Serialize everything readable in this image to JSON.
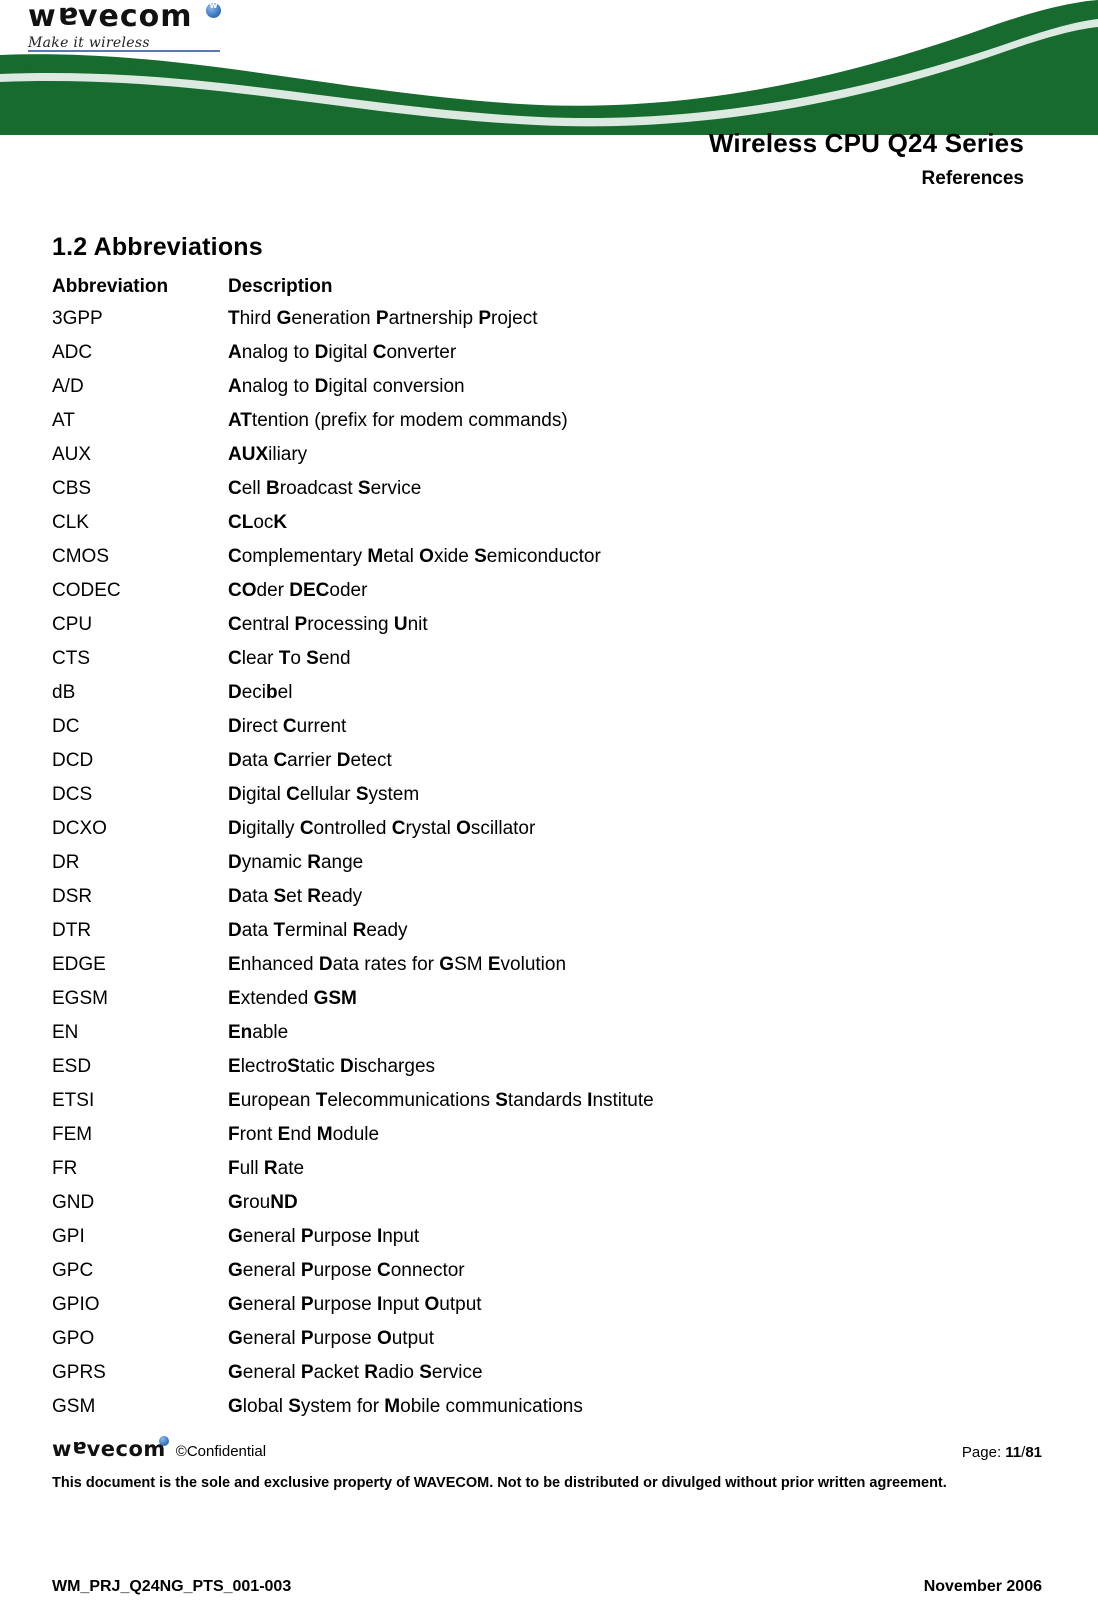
{
  "brand": {
    "logo_text_a": "w",
    "logo_text_b": "a",
    "logo_text_c": "vecom",
    "tagline": "Make it wireless",
    "accent_green": "#176b2f",
    "accent_blue": "#3f7fc4"
  },
  "header": {
    "doc_title": "Wireless CPU Q24 Series",
    "doc_subtitle": "References"
  },
  "section": {
    "heading": "1.2 Abbreviations"
  },
  "table": {
    "col_abbreviation": "Abbreviation",
    "col_description": "Description",
    "rows": [
      {
        "abbr": "3GPP",
        "parts": [
          [
            "T",
            1
          ],
          [
            "hird ",
            0
          ],
          [
            "G",
            1
          ],
          [
            "eneration ",
            0
          ],
          [
            "P",
            1
          ],
          [
            "artnership ",
            0
          ],
          [
            "P",
            1
          ],
          [
            "roject",
            0
          ]
        ]
      },
      {
        "abbr": "ADC",
        "parts": [
          [
            "A",
            1
          ],
          [
            "nalog to ",
            0
          ],
          [
            "D",
            1
          ],
          [
            "igital ",
            0
          ],
          [
            "C",
            1
          ],
          [
            "onverter",
            0
          ]
        ]
      },
      {
        "abbr": "A/D",
        "parts": [
          [
            "A",
            1
          ],
          [
            "nalog to ",
            0
          ],
          [
            "D",
            1
          ],
          [
            "igital conversion",
            0
          ]
        ]
      },
      {
        "abbr": "AT",
        "parts": [
          [
            "AT",
            1
          ],
          [
            "tention (prefix for modem commands)",
            0
          ]
        ]
      },
      {
        "abbr": "AUX",
        "parts": [
          [
            "AUX",
            1
          ],
          [
            "iliary",
            0
          ]
        ]
      },
      {
        "abbr": "CBS",
        "parts": [
          [
            "C",
            1
          ],
          [
            "ell ",
            0
          ],
          [
            "B",
            1
          ],
          [
            "roadcast ",
            0
          ],
          [
            "S",
            1
          ],
          [
            "ervice",
            0
          ]
        ]
      },
      {
        "abbr": "CLK",
        "parts": [
          [
            "CL",
            1
          ],
          [
            "oc",
            0
          ],
          [
            "K",
            1
          ]
        ]
      },
      {
        "abbr": "CMOS",
        "parts": [
          [
            "C",
            1
          ],
          [
            "omplementary ",
            0
          ],
          [
            "M",
            1
          ],
          [
            "etal ",
            0
          ],
          [
            "O",
            1
          ],
          [
            "xide ",
            0
          ],
          [
            "S",
            1
          ],
          [
            "emiconductor",
            0
          ]
        ]
      },
      {
        "abbr": "CODEC",
        "parts": [
          [
            "CO",
            1
          ],
          [
            "der ",
            0
          ],
          [
            "DEC",
            1
          ],
          [
            "oder",
            0
          ]
        ]
      },
      {
        "abbr": "CPU",
        "parts": [
          [
            "C",
            1
          ],
          [
            "entral ",
            0
          ],
          [
            "P",
            1
          ],
          [
            "rocessing ",
            0
          ],
          [
            "U",
            1
          ],
          [
            "nit",
            0
          ]
        ]
      },
      {
        "abbr": "CTS",
        "parts": [
          [
            "C",
            1
          ],
          [
            "lear ",
            0
          ],
          [
            "T",
            1
          ],
          [
            "o ",
            0
          ],
          [
            "S",
            1
          ],
          [
            "end",
            0
          ]
        ]
      },
      {
        "abbr": "dB",
        "parts": [
          [
            "D",
            1
          ],
          [
            "eci",
            0
          ],
          [
            "b",
            1
          ],
          [
            "el",
            0
          ]
        ]
      },
      {
        "abbr": "DC",
        "parts": [
          [
            "D",
            1
          ],
          [
            "irect ",
            0
          ],
          [
            "C",
            1
          ],
          [
            "urrent",
            0
          ]
        ]
      },
      {
        "abbr": "DCD",
        "parts": [
          [
            "D",
            1
          ],
          [
            "ata ",
            0
          ],
          [
            "C",
            1
          ],
          [
            "arrier ",
            0
          ],
          [
            "D",
            1
          ],
          [
            "etect",
            0
          ]
        ]
      },
      {
        "abbr": "DCS",
        "parts": [
          [
            "D",
            1
          ],
          [
            "igital ",
            0
          ],
          [
            "C",
            1
          ],
          [
            "ellular ",
            0
          ],
          [
            "S",
            1
          ],
          [
            "ystem",
            0
          ]
        ]
      },
      {
        "abbr": "DCXO",
        "parts": [
          [
            "D",
            1
          ],
          [
            "igitally ",
            0
          ],
          [
            "C",
            1
          ],
          [
            "ontrolled ",
            0
          ],
          [
            "C",
            1
          ],
          [
            "rystal ",
            0
          ],
          [
            "O",
            1
          ],
          [
            "scillator",
            0
          ]
        ]
      },
      {
        "abbr": "DR",
        "parts": [
          [
            "D",
            1
          ],
          [
            "ynamic ",
            0
          ],
          [
            "R",
            1
          ],
          [
            "ange",
            0
          ]
        ]
      },
      {
        "abbr": "DSR",
        "parts": [
          [
            "D",
            1
          ],
          [
            "ata ",
            0
          ],
          [
            "S",
            1
          ],
          [
            "et ",
            0
          ],
          [
            "R",
            1
          ],
          [
            "eady",
            0
          ]
        ]
      },
      {
        "abbr": "DTR",
        "parts": [
          [
            "D",
            1
          ],
          [
            "ata ",
            0
          ],
          [
            "T",
            1
          ],
          [
            "erminal ",
            0
          ],
          [
            "R",
            1
          ],
          [
            "eady",
            0
          ]
        ]
      },
      {
        "abbr": "EDGE",
        "parts": [
          [
            "E",
            1
          ],
          [
            "nhanced ",
            0
          ],
          [
            "D",
            1
          ],
          [
            "ata rates for ",
            0
          ],
          [
            "G",
            1
          ],
          [
            "SM ",
            0
          ],
          [
            "E",
            1
          ],
          [
            "volution",
            0
          ]
        ]
      },
      {
        "abbr": "EGSM",
        "parts": [
          [
            "E",
            1
          ],
          [
            "xtended ",
            0
          ],
          [
            "GSM",
            1
          ]
        ]
      },
      {
        "abbr": "EN",
        "parts": [
          [
            "En",
            1
          ],
          [
            "able",
            0
          ]
        ]
      },
      {
        "abbr": "ESD",
        "parts": [
          [
            "E",
            1
          ],
          [
            "lectro",
            0
          ],
          [
            "S",
            1
          ],
          [
            "tatic ",
            0
          ],
          [
            "D",
            1
          ],
          [
            "ischarges",
            0
          ]
        ]
      },
      {
        "abbr": "ETSI",
        "parts": [
          [
            "E",
            1
          ],
          [
            "uropean ",
            0
          ],
          [
            "T",
            1
          ],
          [
            "elecommunications ",
            0
          ],
          [
            "S",
            1
          ],
          [
            "tandards ",
            0
          ],
          [
            "I",
            1
          ],
          [
            "nstitute",
            0
          ]
        ]
      },
      {
        "abbr": "FEM",
        "parts": [
          [
            "F",
            1
          ],
          [
            "ront ",
            0
          ],
          [
            "E",
            1
          ],
          [
            "nd ",
            0
          ],
          [
            "M",
            1
          ],
          [
            "odule",
            0
          ]
        ]
      },
      {
        "abbr": "FR",
        "parts": [
          [
            "F",
            1
          ],
          [
            "ull ",
            0
          ],
          [
            "R",
            1
          ],
          [
            "ate",
            0
          ]
        ]
      },
      {
        "abbr": "GND",
        "parts": [
          [
            "G",
            1
          ],
          [
            "rou",
            0
          ],
          [
            "ND",
            1
          ]
        ]
      },
      {
        "abbr": "GPI",
        "parts": [
          [
            "G",
            1
          ],
          [
            "eneral ",
            0
          ],
          [
            "P",
            1
          ],
          [
            "urpose ",
            0
          ],
          [
            "I",
            1
          ],
          [
            "nput",
            0
          ]
        ]
      },
      {
        "abbr": "GPC",
        "parts": [
          [
            "G",
            1
          ],
          [
            "eneral ",
            0
          ],
          [
            "P",
            1
          ],
          [
            "urpose ",
            0
          ],
          [
            "C",
            1
          ],
          [
            "onnector",
            0
          ]
        ]
      },
      {
        "abbr": "GPIO",
        "parts": [
          [
            "G",
            1
          ],
          [
            "eneral ",
            0
          ],
          [
            "P",
            1
          ],
          [
            "urpose ",
            0
          ],
          [
            "I",
            1
          ],
          [
            "nput ",
            0
          ],
          [
            "O",
            1
          ],
          [
            "utput",
            0
          ]
        ]
      },
      {
        "abbr": "GPO",
        "parts": [
          [
            "G",
            1
          ],
          [
            "eneral ",
            0
          ],
          [
            "P",
            1
          ],
          [
            "urpose ",
            0
          ],
          [
            "O",
            1
          ],
          [
            "utput",
            0
          ]
        ]
      },
      {
        "abbr": "GPRS",
        "parts": [
          [
            "G",
            1
          ],
          [
            "eneral ",
            0
          ],
          [
            "P",
            1
          ],
          [
            "acket ",
            0
          ],
          [
            "R",
            1
          ],
          [
            "adio ",
            0
          ],
          [
            "S",
            1
          ],
          [
            "ervice",
            0
          ]
        ]
      },
      {
        "abbr": "GSM",
        "parts": [
          [
            "G",
            1
          ],
          [
            "lobal ",
            0
          ],
          [
            "S",
            1
          ],
          [
            "ystem for ",
            0
          ],
          [
            "M",
            1
          ],
          [
            "obile communications",
            0
          ]
        ]
      }
    ]
  },
  "footer": {
    "confidential": "©Confidential",
    "page_label": "Page:",
    "page_current": "11",
    "page_separator": "/",
    "page_total": "81",
    "legal": "This document is the sole and exclusive property of WAVECOM. Not to be distributed or divulged without prior written agreement.",
    "doc_id": "WM_PRJ_Q24NG_PTS_001-003",
    "doc_date": "November 2006"
  }
}
